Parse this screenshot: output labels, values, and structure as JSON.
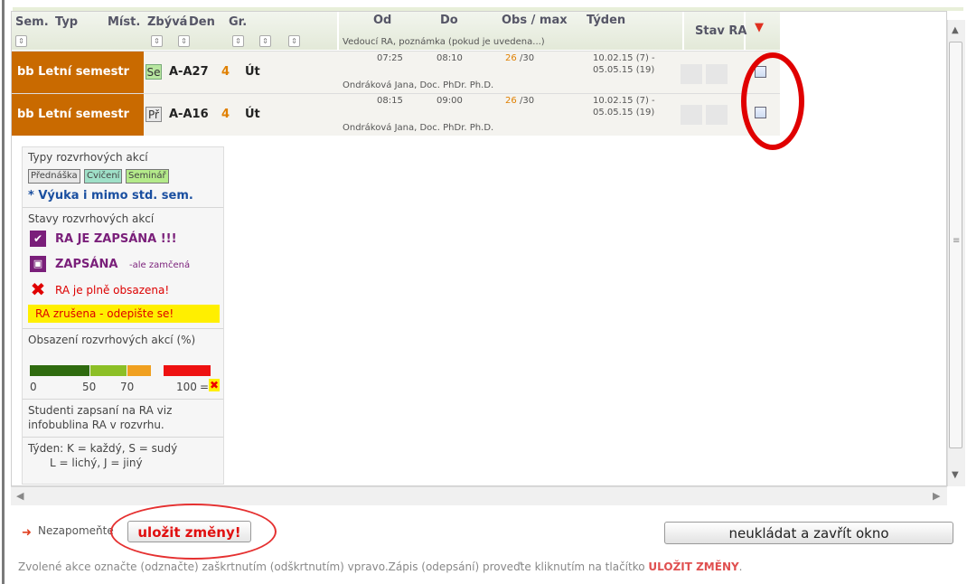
{
  "header": {
    "sem": "Sem.",
    "typ": "Typ",
    "mist": "Míst.",
    "zbyva": "Zbývá",
    "den": "Den",
    "gr": "Gr.",
    "od": "Od",
    "do": "Do",
    "obs_max": "Obs / max",
    "tyden": "Týden",
    "stav_ra": "Stav RA",
    "vedouci_note": "Vedoucí RA, poznámka (pokud je uvedena...)"
  },
  "rows": [
    {
      "semestr": "bb Letní semestr",
      "typ": "Se",
      "mistnost": "A-A27",
      "zbyva": "4",
      "den": "Út",
      "od": "07:25",
      "do": "08:10",
      "obs": "26",
      "max": "/30",
      "tyden": "10.02.15 (7) -",
      "tyden2": "05.05.15 (19)",
      "vedouci": "Ondráková Jana, Doc. PhDr. Ph.D."
    },
    {
      "semestr": "bb Letní semestr",
      "typ": "Př",
      "mistnost": "A-A16",
      "zbyva": "4",
      "den": "Út",
      "od": "08:15",
      "do": "09:00",
      "obs": "26",
      "max": "/30",
      "tyden": "10.02.15 (7) -",
      "tyden2": "05.05.15 (19)",
      "vedouci": "Ondráková Jana, Doc. PhDr. Ph.D."
    }
  ],
  "legend": {
    "typy_title": "Typy rozvrhových akcí",
    "prednaska": "Přednáška",
    "cviceni": "Cvičení",
    "seminar": "Seminář",
    "vyuka": "* Výuka i mimo std. sem.",
    "stavy_title": "Stavy rozvrhových akcí",
    "zapsana": "RA JE ZAPSÁNA !!!",
    "zamcena": "ZAPSÁNA",
    "zamcena_small": "-ale zamčená",
    "obsazena": "RA je plně obsazena!",
    "zrusena": "RA zrušena - odepište se!",
    "obsazeni_title": "Obsazení rozvrhových akcí (%)",
    "scale_0": "0",
    "scale_50": "50",
    "scale_70": "70",
    "scale_100": "100",
    "studenti": "Studenti zapsaní na RA viz",
    "studenti2": "infobublina RA v rozvrhu.",
    "tyden_line1": "Týden: K = každý, S = sudý",
    "tyden_line2": "L = lichý, J = jiný"
  },
  "footer": {
    "nezapomente": "Nezapomeňte",
    "save": "uložit změny!",
    "close": "neukládat a zavřít okno",
    "info_prefix": "Zvolené akce označte (odznačte) zaškrtnutím (odškrtnutím) vpravo.Zápis (odepsání) proveďte kliknutím na tlačítko",
    "info_strong": "ULOŽIT ZMĚNY",
    "info_suffix": "."
  },
  "colors": {
    "semestr_bg": "#c96a00",
    "accent_red": "#e01010",
    "occupancy": [
      "#2f6b0f",
      "#8cbf26",
      "#f0a020",
      "#ee1111"
    ]
  }
}
